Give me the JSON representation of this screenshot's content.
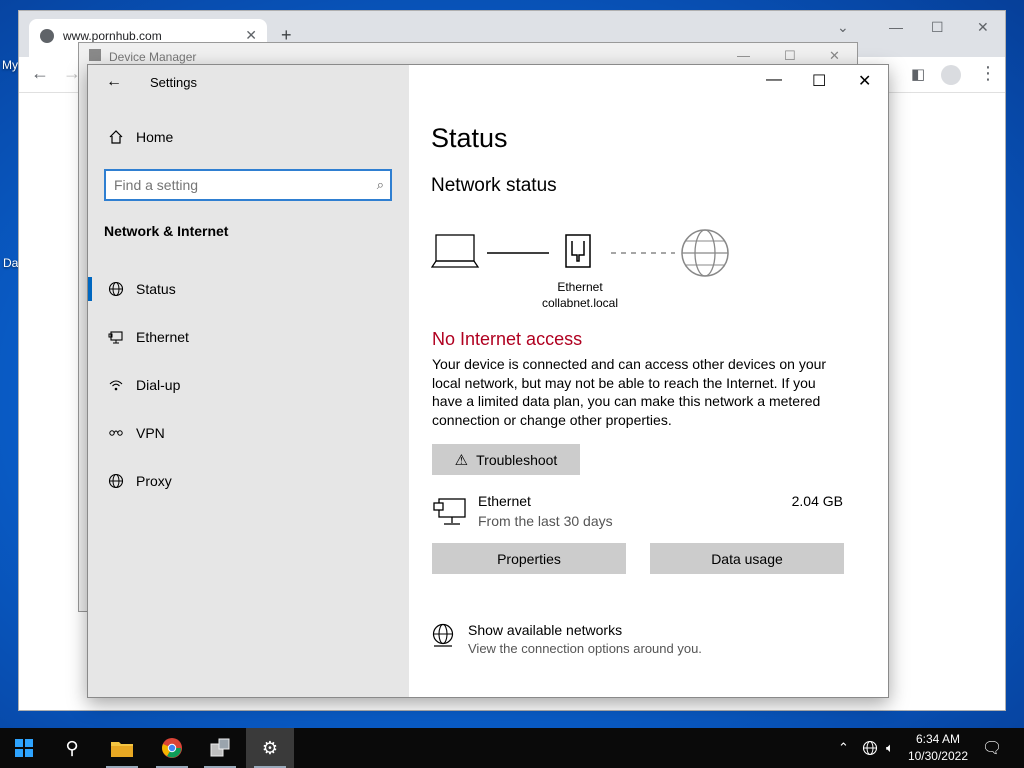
{
  "desktop": {
    "labels": [
      "My",
      "Da"
    ]
  },
  "browser": {
    "tab_title": "www.pornhub.com",
    "new_tab": "+",
    "chevron": "⌄"
  },
  "device_manager": {
    "title": "Device Manager"
  },
  "settings": {
    "app_title": "Settings",
    "home_label": "Home",
    "search_placeholder": "Find a setting",
    "section_heading": "Network & Internet",
    "nav_items": [
      {
        "label": "Status",
        "icon": "status-globe-icon",
        "active": true
      },
      {
        "label": "Ethernet",
        "icon": "ethernet-icon"
      },
      {
        "label": "Dial-up",
        "icon": "dialup-icon"
      },
      {
        "label": "VPN",
        "icon": "vpn-icon"
      },
      {
        "label": "Proxy",
        "icon": "proxy-globe-icon"
      }
    ],
    "main": {
      "title": "Status",
      "subtitle": "Network status",
      "diagram_label_1": "Ethernet",
      "diagram_label_2": "collabnet.local",
      "warning": "No Internet access",
      "description": "Your device is connected and can access other devices on your local network, but may not be able to reach the Internet. If you have a limited data plan, you can make this network a metered connection or change other properties.",
      "troubleshoot_label": "Troubleshoot",
      "ethernet_name": "Ethernet",
      "ethernet_period": "From the last 30 days",
      "ethernet_usage": "2.04 GB",
      "properties_label": "Properties",
      "data_usage_label": "Data usage",
      "show_networks_label": "Show available networks",
      "show_networks_desc": "View the connection options around you."
    }
  },
  "taskbar": {
    "time": "6:34 AM",
    "date": "10/30/2022"
  },
  "colors": {
    "accent": "#0067c0",
    "warning": "#b00020",
    "sidebar_bg": "#e6e6e6",
    "button_bg": "#cccccc"
  }
}
